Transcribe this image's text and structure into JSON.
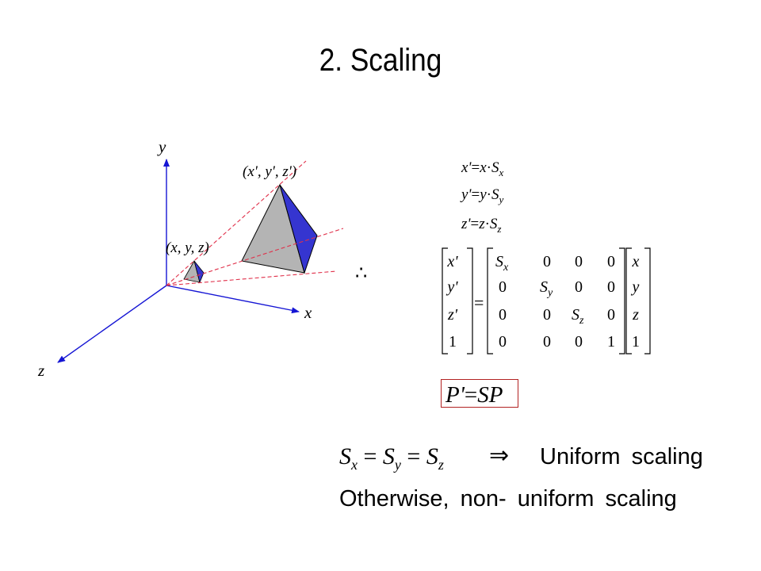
{
  "slide": {
    "title": "2. Scaling"
  },
  "diagram": {
    "axes": {
      "x_label": "x",
      "y_label": "y",
      "z_label": "z"
    },
    "original_point_label": "(x, y, z)",
    "scaled_point_label": "(x', y', z')",
    "colors": {
      "axis": "#1515d4",
      "projection_lines": "#e0304a",
      "face_front": "#b4b4b4",
      "face_side": "#3535d0",
      "edge": "#000000"
    }
  },
  "equations": {
    "component": [
      {
        "lhs": "x'",
        "var": "x",
        "factor": "S",
        "sub": "x"
      },
      {
        "lhs": "y'",
        "var": "y",
        "factor": "S",
        "sub": "y"
      },
      {
        "lhs": "z'",
        "var": "z",
        "factor": "S",
        "sub": "z"
      }
    ],
    "therefore_symbol": "∴",
    "matrix_form": {
      "lhs_vector": [
        "x'",
        "y'",
        "z'",
        "1"
      ],
      "equals": "=",
      "matrix": [
        [
          "Sx",
          "0",
          "0",
          "0"
        ],
        [
          "0",
          "Sy",
          "0",
          "0"
        ],
        [
          "0",
          "0",
          "Sz",
          "0"
        ],
        [
          "0",
          "0",
          "0",
          "1"
        ]
      ],
      "rhs_vector": [
        "x",
        "y",
        "z",
        "1"
      ]
    },
    "compact_form": "P' = SP",
    "compact_parts": {
      "lhs": "P'",
      "eq": "=",
      "rhs": "SP"
    }
  },
  "notes": {
    "uniform_condition": "Sx = Sy = Sz",
    "implies": "⇒",
    "uniform_label": "Uniform scaling",
    "otherwise_label": "Otherwise, non- uniform scaling"
  }
}
